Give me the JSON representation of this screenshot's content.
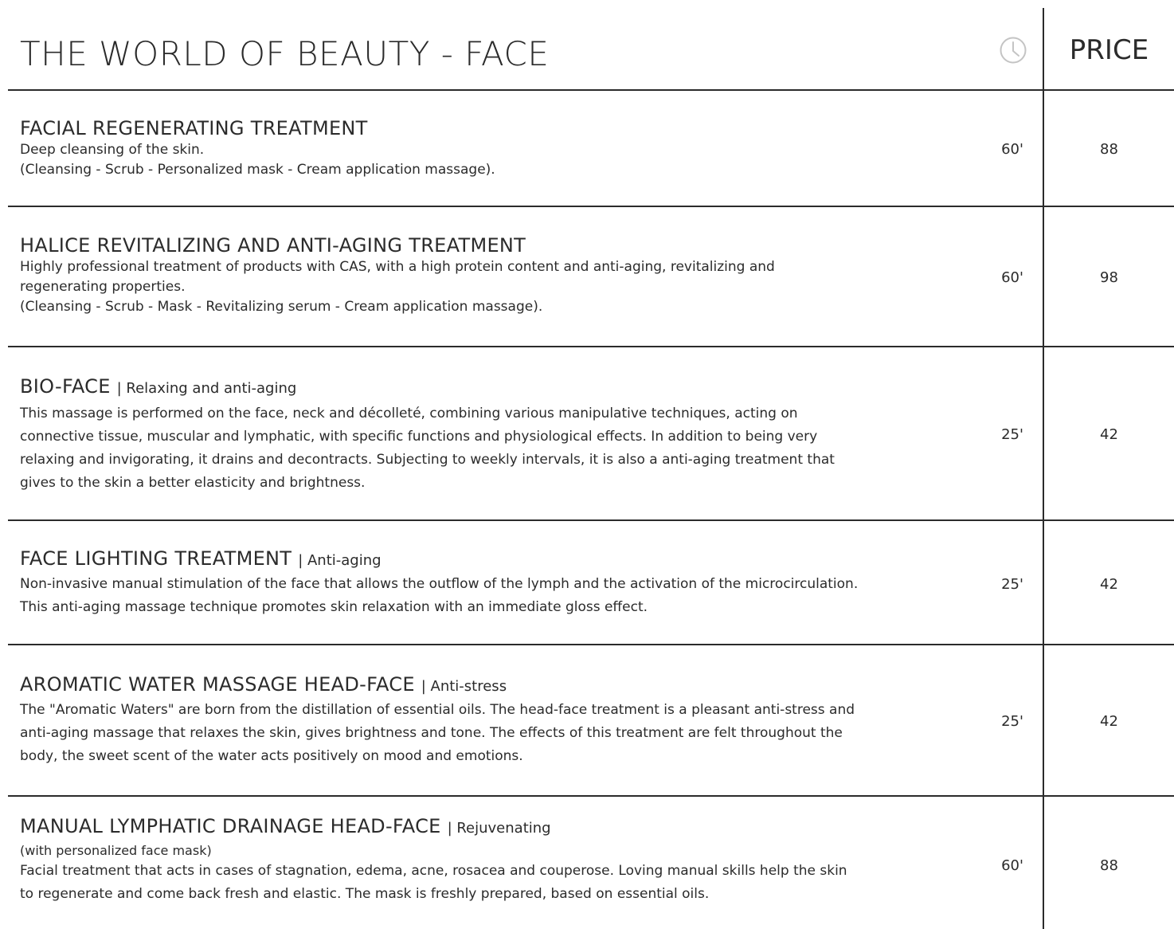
{
  "header": {
    "title": "THE WORLD OF BEAUTY - FACE",
    "duration_icon": "clock-icon",
    "price_label": "PRICE"
  },
  "colors": {
    "text": "#2b2b2b",
    "icon": "#c4c4c4",
    "rule": "#2b2b2b"
  },
  "treatments": [
    {
      "name": "FACIAL REGENERATING TREATMENT",
      "tag": "",
      "note": "",
      "description": "Deep cleansing of the skin.\n(Cleansing - Scrub - Personalized mask - Cream application massage).",
      "duration": "60'",
      "price": "88"
    },
    {
      "name": "HALICE REVITALIZING AND ANTI-AGING TREATMENT",
      "tag": "",
      "note": "",
      "description": "Highly professional treatment of products with CAS, with a high protein content and anti-aging, revitalizing and\nregenerating properties.\n(Cleansing - Scrub - Mask - Revitalizing serum - Cream application massage).",
      "duration": "60'",
      "price": "98"
    },
    {
      "name": "BIO-FACE",
      "tag": "| Relaxing and anti-aging",
      "note": "",
      "description": "This massage is performed on the face, neck and décolleté, combining various manipulative techniques, acting on\nconnective tissue, muscular and lymphatic, with specific functions and physiological effects. In addition to being very\nrelaxing and invigorating, it drains and decontracts. Subjecting to weekly intervals, it is also a anti-aging treatment that\ngives to the skin a better elasticity and brightness.",
      "duration": "25'",
      "price": "42"
    },
    {
      "name": "FACE LIGHTING TREATMENT",
      "tag": "| Anti-aging",
      "note": "",
      "description": "Non-invasive manual stimulation of the face that allows the outflow of the lymph and the activation of the microcirculation.\nThis anti-aging massage technique promotes skin relaxation with an immediate gloss effect.",
      "duration": "25'",
      "price": "42"
    },
    {
      "name": "AROMATIC WATER MASSAGE HEAD-FACE",
      "tag": "| Anti-stress",
      "note": "",
      "description": "The \"Aromatic Waters\" are born from the distillation of essential oils. The head-face treatment is a pleasant anti-stress and\nanti-aging massage that relaxes the skin, gives brightness and tone. The effects of this treatment are felt throughout the\nbody, the sweet scent of the water acts positively on mood and emotions.",
      "duration": "25'",
      "price": "42"
    },
    {
      "name": "MANUAL LYMPHATIC DRAINAGE HEAD-FACE",
      "tag": "| Rejuvenating",
      "note": "(with personalized face mask)",
      "description": "Facial treatment that acts in cases of stagnation, edema, acne, rosacea and couperose. Loving manual skills help the skin\nto regenerate and come back fresh and elastic. The mask is freshly prepared, based on essential oils.",
      "duration": "60'",
      "price": "88"
    }
  ]
}
